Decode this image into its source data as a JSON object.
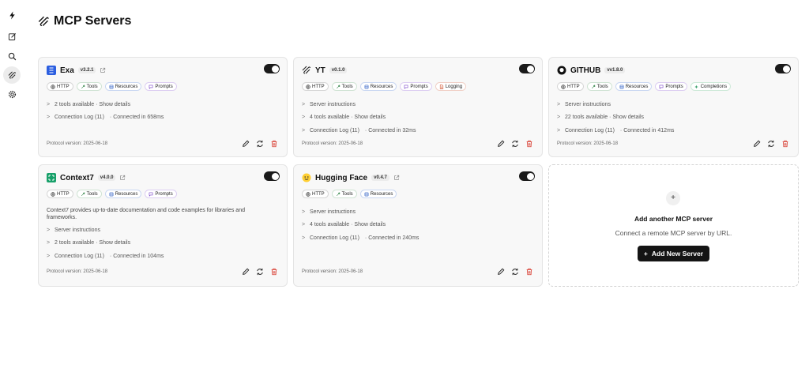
{
  "page": {
    "title": "MCP Servers"
  },
  "sidebar": {
    "items": [
      {
        "icon": "bolt-icon"
      },
      {
        "icon": "edit-icon"
      },
      {
        "icon": "search-icon"
      },
      {
        "icon": "mcp-icon"
      },
      {
        "icon": "gear-icon"
      }
    ]
  },
  "cards": [
    {
      "name": "Exa",
      "version": "v3.2.1",
      "chips": [
        "HTTP",
        "Tools",
        "Resources",
        "Prompts"
      ],
      "rows": [
        "2 tools available · Show details",
        "Connection Log (11)",
        "· Connected in 658ms"
      ],
      "protocol": "Protocol version: 2025-06-18"
    },
    {
      "name": "YT",
      "version": "v0.1.0",
      "chips": [
        "HTTP",
        "Tools",
        "Resources",
        "Prompts",
        "Logging"
      ],
      "rows": [
        "Server instructions",
        "4 tools available · Show details",
        "Connection Log (11)",
        "· Connected in 32ms"
      ],
      "protocol": "Protocol version: 2025-06-18"
    },
    {
      "name": "GITHUB",
      "version": "vv1.8.0",
      "chips": [
        "HTTP",
        "Tools",
        "Resources",
        "Prompts",
        "Completions"
      ],
      "rows": [
        "Server instructions",
        "22 tools available · Show details",
        "Connection Log (11)",
        "· Connected in 412ms"
      ],
      "protocol": "Protocol version: 2025-06-18"
    },
    {
      "name": "Context7",
      "version": "v4.0.0",
      "chips": [
        "HTTP",
        "Tools",
        "Resources",
        "Prompts"
      ],
      "description": "Context7 provides up-to-date documentation and code examples for libraries and frameworks.",
      "rows": [
        "Server instructions",
        "2 tools available · Show details",
        "Connection Log (11)",
        "· Connected in 104ms"
      ],
      "protocol": "Protocol version: 2025-06-18"
    },
    {
      "name": "Hugging Face",
      "version": "v0.4.7",
      "chips": [
        "HTTP",
        "Tools",
        "Resources"
      ],
      "rows": [
        "Server instructions",
        "4 tools available · Show details",
        "Connection Log (11)",
        "· Connected in 240ms"
      ],
      "protocol": "Protocol version: 2025-06-18"
    }
  ],
  "add_card": {
    "title": "Add another MCP server",
    "subtitle": "Connect a remote MCP server by URL.",
    "button": "Add New Server"
  }
}
